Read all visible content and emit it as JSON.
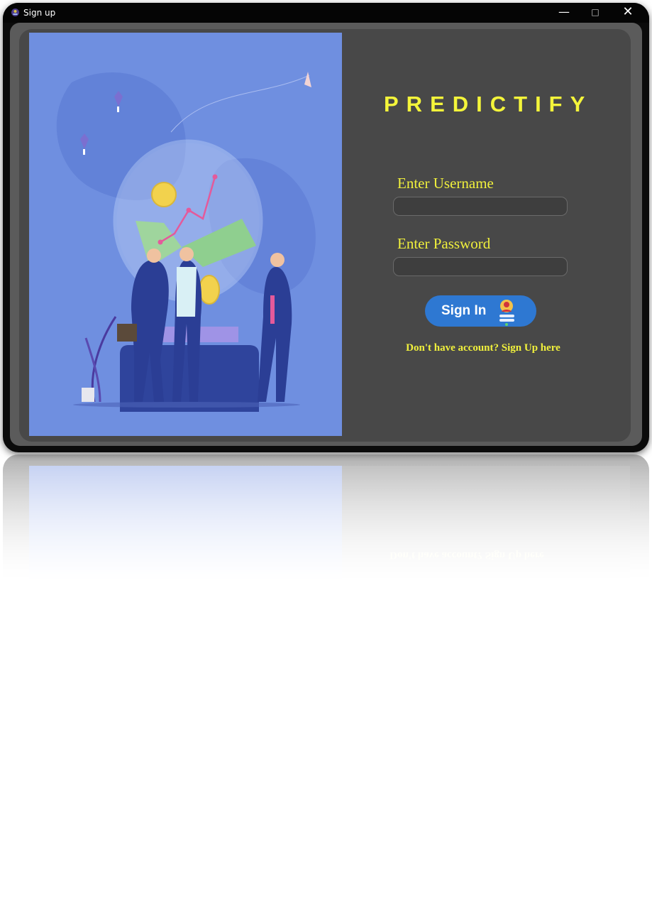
{
  "window": {
    "title": "Sign up",
    "controls": {
      "minimize": "—",
      "maximize": "□",
      "close": "✕"
    }
  },
  "brand": {
    "name": "PREDICTIFY"
  },
  "form": {
    "username_label": "Enter Username",
    "username_value": "",
    "password_label": "Enter Password",
    "password_value": "",
    "signin_label": "Sign In",
    "signup_link": "Don't have account? Sign Up here"
  },
  "colors": {
    "accent_yellow": "#f4f53a",
    "button_blue": "#2e78d2",
    "panel": "#484848",
    "illustration_bg": "#6f8fe0"
  },
  "icons": {
    "app": "app-icon",
    "signin": "user-login-icon"
  }
}
